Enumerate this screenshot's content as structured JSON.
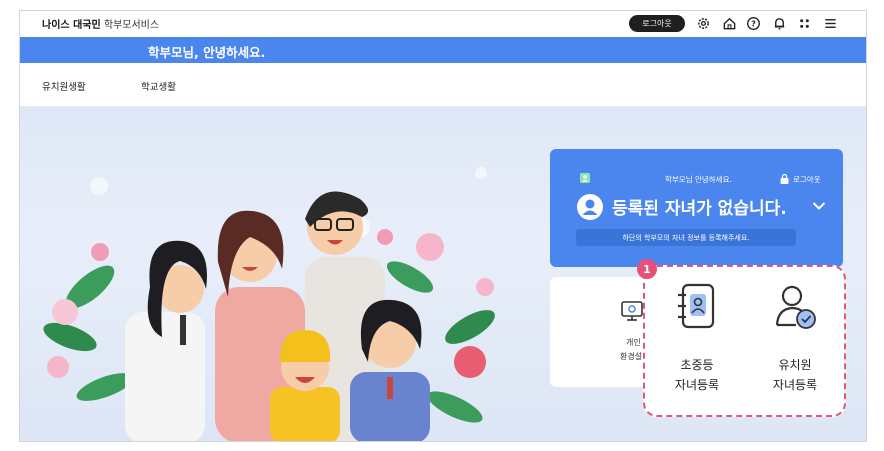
{
  "header": {
    "brand_bold": "나이스 대국민",
    "brand_sub": "학부모서비스",
    "logout_button": "로그아웃",
    "icons": [
      "gear-icon",
      "home-icon",
      "help-icon",
      "bell-icon",
      "apps-icon",
      "menu-icon"
    ]
  },
  "banner": {
    "greeting": "학부모님, 안녕하세요."
  },
  "nav": {
    "items": [
      {
        "label": "유치원생활"
      },
      {
        "label": "학교생활"
      }
    ]
  },
  "card": {
    "greeting": "학부모님 안녕하세요.",
    "logout": "로그아웃",
    "title": "등록된 자녀가 없습니다.",
    "hint": "하단의 학부모의 자녀 정보를 등록해주세요."
  },
  "settings_card": {
    "label_line1": "개인",
    "label_line2": "환경설"
  },
  "register": {
    "badge": "1",
    "options": [
      {
        "line1": "초중등",
        "line2": "자녀등록"
      },
      {
        "line1": "유치원",
        "line2": "자녀등록"
      }
    ]
  },
  "colors": {
    "accent": "#4a86ee",
    "highlight": "#e0577d",
    "dark": "#1f1f1f"
  }
}
